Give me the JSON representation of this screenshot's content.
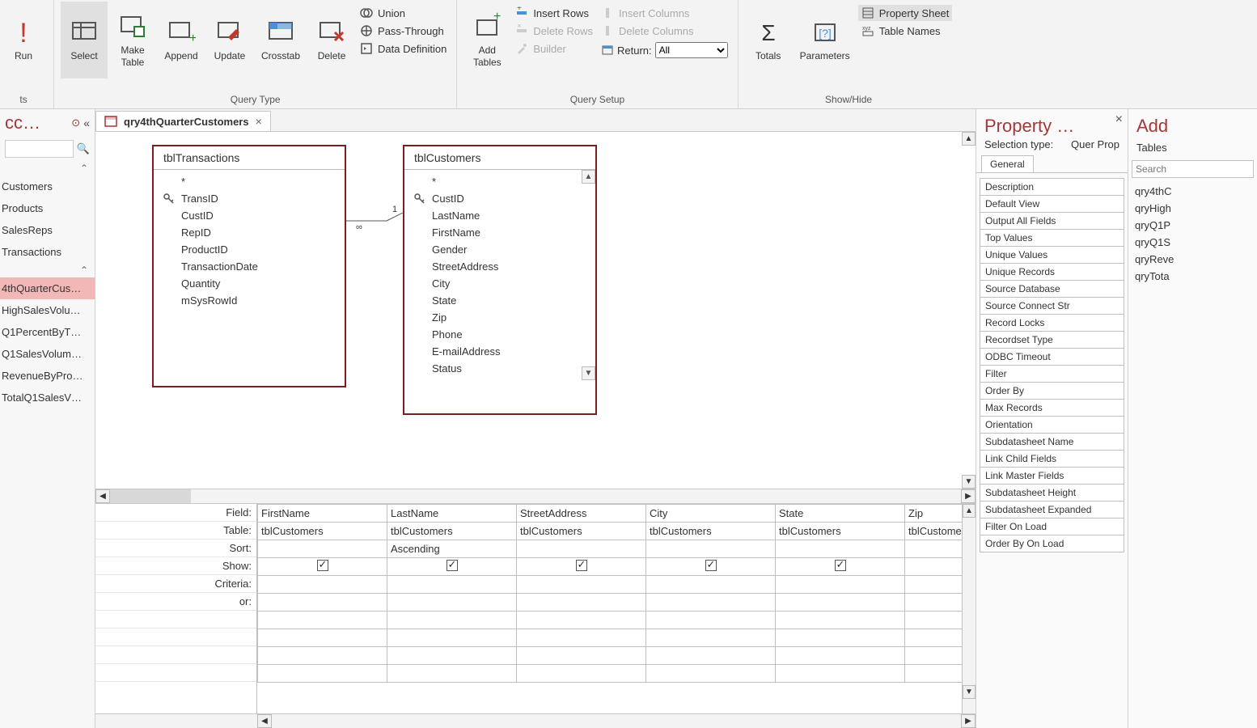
{
  "ribbon": {
    "run": "Run",
    "queryType": {
      "groupLabel": "Query Type",
      "select": "Select",
      "makeTable": "Make\nTable",
      "append": "Append",
      "update": "Update",
      "crosstab": "Crosstab",
      "delete": "Delete",
      "union": "Union",
      "passThrough": "Pass-Through",
      "dataDef": "Data Definition"
    },
    "querySetup": {
      "groupLabel": "Query Setup",
      "addTables": "Add\nTables",
      "insertRows": "Insert Rows",
      "deleteRows": "Delete Rows",
      "builder": "Builder",
      "insertCols": "Insert Columns",
      "deleteCols": "Delete Columns",
      "return": "Return:",
      "returnValue": "All"
    },
    "showHide": {
      "groupLabel": "Show/Hide",
      "totals": "Totals",
      "parameters": "Parameters",
      "propertySheet": "Property Sheet",
      "tableNames": "Table Names"
    }
  },
  "nav": {
    "title": "cc…",
    "tablesHeader": "ts",
    "tables": [
      "Customers",
      "Products",
      "SalesReps",
      "Transactions"
    ],
    "queries": [
      "4thQuarterCus…",
      "HighSalesVolu…",
      "Q1PercentByT…",
      "Q1SalesVolum…",
      "RevenueByPro…",
      "TotalQ1SalesV…"
    ],
    "selectedQuery": "4thQuarterCus…"
  },
  "tab": {
    "name": "qry4thQuarterCustomers"
  },
  "tables": {
    "tblTransactions": {
      "title": "tblTransactions",
      "fields": [
        "*",
        "TransID",
        "CustID",
        "RepID",
        "ProductID",
        "TransactionDate",
        "Quantity",
        "mSysRowId"
      ],
      "pkIndex": 1
    },
    "tblCustomers": {
      "title": "tblCustomers",
      "fields": [
        "*",
        "CustID",
        "LastName",
        "FirstName",
        "Gender",
        "StreetAddress",
        "City",
        "State",
        "Zip",
        "Phone",
        "E-mailAddress",
        "Status"
      ],
      "pkIndex": 1
    }
  },
  "relation": {
    "leftLabel": "∞",
    "rightLabel": "1"
  },
  "qbe": {
    "rowLabels": [
      "Field:",
      "Table:",
      "Sort:",
      "Show:",
      "Criteria:",
      "or:"
    ],
    "columns": [
      {
        "field": "FirstName",
        "table": "tblCustomers",
        "sort": "",
        "show": true
      },
      {
        "field": "LastName",
        "table": "tblCustomers",
        "sort": "Ascending",
        "show": true
      },
      {
        "field": "StreetAddress",
        "table": "tblCustomers",
        "sort": "",
        "show": true
      },
      {
        "field": "City",
        "table": "tblCustomers",
        "sort": "",
        "show": true
      },
      {
        "field": "State",
        "table": "tblCustomers",
        "sort": "",
        "show": true
      },
      {
        "field": "Zip",
        "table": "tblCustomers",
        "sort": "",
        "show": true
      }
    ]
  },
  "propertySheet": {
    "title": "Property …",
    "selLabel": "Selection type:",
    "selValue": "Quer Prop",
    "tab": "General",
    "items": [
      "Description",
      "Default View",
      "Output All Fields",
      "Top Values",
      "Unique Values",
      "Unique Records",
      "Source Database",
      "Source Connect Str",
      "Record Locks",
      "Recordset Type",
      "ODBC Timeout",
      "Filter",
      "Order By",
      "Max Records",
      "Orientation",
      "Subdatasheet Name",
      "Link Child Fields",
      "Link Master Fields",
      "Subdatasheet Height",
      "Subdatasheet Expanded",
      "Filter On Load",
      "Order By On Load"
    ]
  },
  "addPane": {
    "title": "Add",
    "tab": "Tables",
    "searchPlaceholder": "Search",
    "items": [
      "qry4thC",
      "qryHigh",
      "qryQ1P",
      "qryQ1S",
      "qryReve",
      "qryTota"
    ]
  }
}
